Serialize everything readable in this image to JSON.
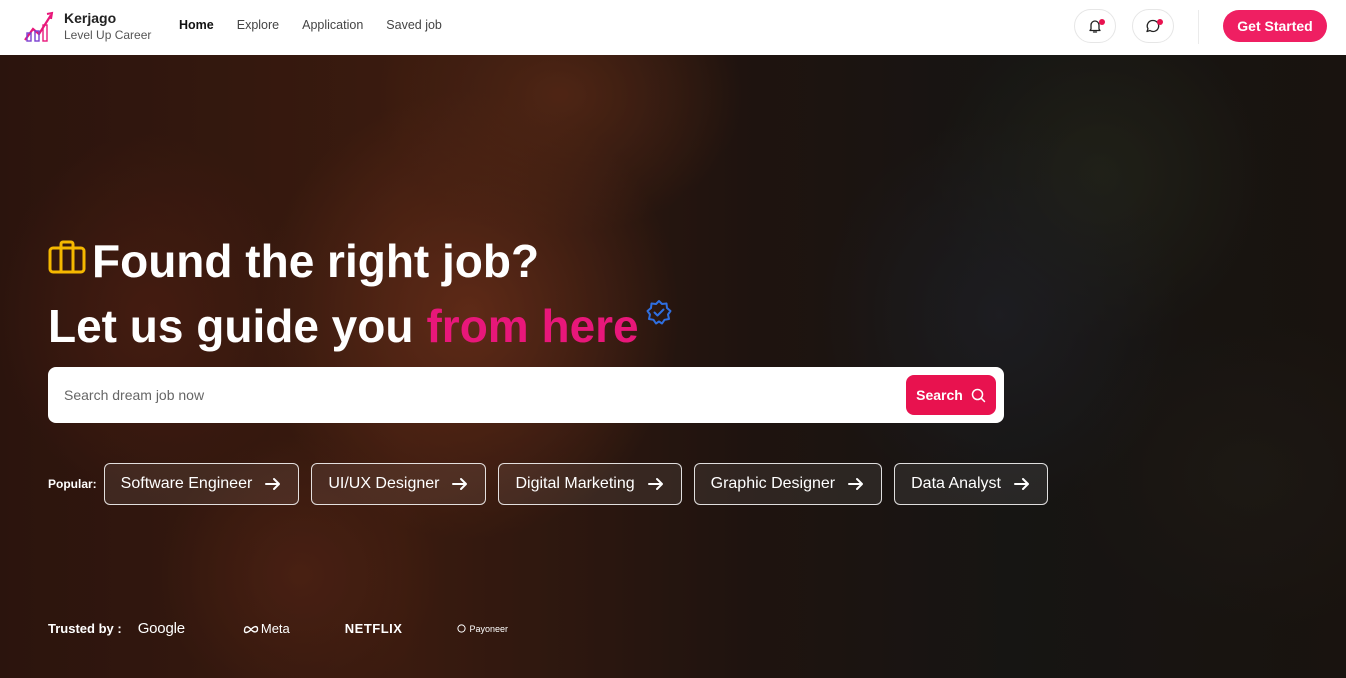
{
  "brand": {
    "name": "Kerjago",
    "tagline": "Level Up Career",
    "icon": "career-growth-logo-icon"
  },
  "nav": {
    "links": [
      {
        "label": "Home",
        "active": true
      },
      {
        "label": "Explore",
        "active": false
      },
      {
        "label": "Application",
        "active": false
      },
      {
        "label": "Saved job",
        "active": false
      }
    ],
    "notification_icon": "bell-icon",
    "message_icon": "chat-bubble-icon",
    "cta_label": "Get Started"
  },
  "hero": {
    "line1": "Found the right job?",
    "line2_prefix": "Let us guide you",
    "line2_accent": "from here",
    "search_placeholder": "Search dream job now",
    "search_button": "Search",
    "popular_label": "Popular:",
    "popular_chips": [
      "Software Engineer",
      "UI/UX Designer",
      "Digital Marketing",
      "Graphic Designer",
      "Data Analyst"
    ],
    "trusted_label": "Trusted by :",
    "trusted_logos": [
      "Google",
      "Meta",
      "NETFLIX",
      "Payoneer"
    ]
  },
  "colors": {
    "accent": "#e8124f",
    "headline_accent": "#e8177a",
    "briefcase": "#f5b800",
    "verified": "#2f6fe0"
  }
}
